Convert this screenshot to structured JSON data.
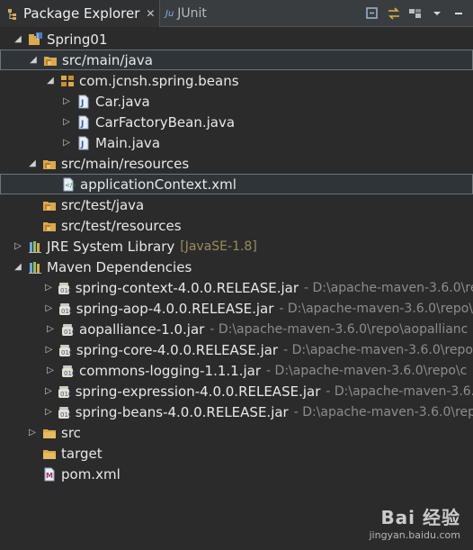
{
  "tabs": [
    {
      "label": "Package Explorer",
      "active": true,
      "icon": "package-explorer-icon"
    },
    {
      "label": "JUnit",
      "active": false,
      "icon": "junit-icon"
    }
  ],
  "tab_close": "✕",
  "junit_prefix": "Ju",
  "toolbar_icons": [
    "collapse-all-icon",
    "link-with-editor-icon",
    "focus-icon",
    "view-menu-icon",
    "minimize-icon"
  ],
  "tree": [
    {
      "label": "Spring01",
      "icon": "project-icon",
      "twisty": "expanded"
    },
    {
      "label": "src/main/java",
      "icon": "source-folder-icon",
      "twisty": "expanded"
    },
    {
      "label": "com.jcnsh.spring.beans",
      "icon": "package-icon",
      "twisty": "expanded"
    },
    {
      "label": "Car.java",
      "icon": "java-file-icon",
      "twisty": "collapsed"
    },
    {
      "label": "CarFactoryBean.java",
      "icon": "java-file-icon",
      "twisty": "collapsed"
    },
    {
      "label": "Main.java",
      "icon": "java-file-icon",
      "twisty": "collapsed"
    },
    {
      "label": "src/main/resources",
      "icon": "source-folder-icon",
      "twisty": "expanded"
    },
    {
      "label": "applicationContext.xml",
      "icon": "xml-file-icon",
      "twisty": "none"
    },
    {
      "label": "src/test/java",
      "icon": "source-folder-icon",
      "twisty": "none"
    },
    {
      "label": "src/test/resources",
      "icon": "source-folder-icon",
      "twisty": "none"
    },
    {
      "label": "JRE System Library",
      "decoration": "[JavaSE-1.8]",
      "icon": "library-icon",
      "twisty": "collapsed"
    },
    {
      "label": "Maven Dependencies",
      "icon": "library-icon",
      "twisty": "expanded"
    },
    {
      "label": "spring-context-4.0.0.RELEASE.jar",
      "decoration": "- D:\\apache-maven-3.6.0\\re",
      "icon": "jar-icon",
      "twisty": "collapsed"
    },
    {
      "label": "spring-aop-4.0.0.RELEASE.jar",
      "decoration": "- D:\\apache-maven-3.6.0\\repo\\",
      "icon": "jar-icon",
      "twisty": "collapsed"
    },
    {
      "label": "aopalliance-1.0.jar",
      "decoration": "- D:\\apache-maven-3.6.0\\repo\\aopallianc",
      "icon": "jar-icon",
      "twisty": "collapsed"
    },
    {
      "label": "spring-core-4.0.0.RELEASE.jar",
      "decoration": "- D:\\apache-maven-3.6.0\\repo",
      "icon": "jar-icon",
      "twisty": "collapsed"
    },
    {
      "label": "commons-logging-1.1.1.jar",
      "decoration": "- D:\\apache-maven-3.6.0\\repo\\c",
      "icon": "jar-icon",
      "twisty": "collapsed"
    },
    {
      "label": "spring-expression-4.0.0.RELEASE.jar",
      "decoration": "- D:\\apache-maven-3.6.0",
      "icon": "jar-icon",
      "twisty": "collapsed"
    },
    {
      "label": "spring-beans-4.0.0.RELEASE.jar",
      "decoration": "- D:\\apache-maven-3.6.0\\rep",
      "icon": "jar-icon",
      "twisty": "collapsed"
    },
    {
      "label": "src",
      "icon": "folder-icon",
      "twisty": "collapsed"
    },
    {
      "label": "target",
      "icon": "folder-icon",
      "twisty": "none"
    },
    {
      "label": "pom.xml",
      "icon": "maven-pom-icon",
      "twisty": "none"
    }
  ],
  "watermark": {
    "main": "Bai 经验",
    "sub": "jingyan.baidu.com"
  },
  "colors": {
    "background": "#2b2b2b",
    "text": "#e8e8e8",
    "decoration": "#8d8d8d",
    "jre_decoration": "#9b8c5c",
    "folder": "#d9a94c",
    "java": "#6fa8dc"
  }
}
